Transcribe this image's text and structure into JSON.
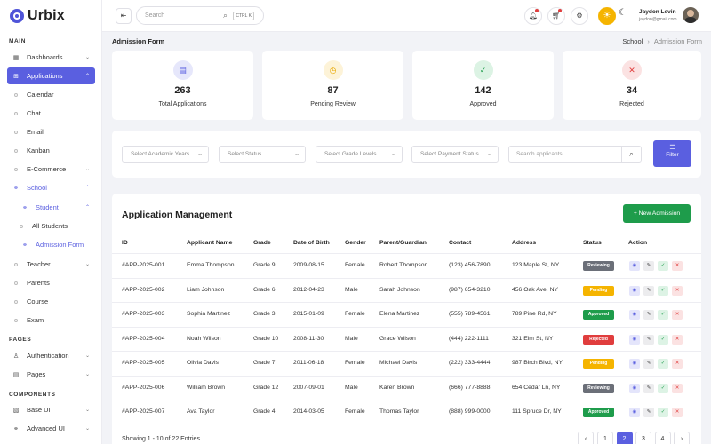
{
  "brand": {
    "name": "Urbix"
  },
  "sidebar": {
    "sections": {
      "main": "MAIN",
      "pages": "PAGES",
      "components": "COMPONENTS"
    },
    "items": {
      "dashboards": "Dashboards",
      "applications": "Applications",
      "calendar": "Calendar",
      "chat": "Chat",
      "email": "Email",
      "kanban": "Kanban",
      "ecommerce": "E-Commerce",
      "school": "School",
      "student": "Student",
      "all_students": "All Students",
      "admission_form": "Admission Form",
      "teacher": "Teacher",
      "parents": "Parents",
      "course": "Course",
      "exam": "Exam",
      "authentication": "Authentication",
      "pages": "Pages",
      "base_ui": "Base UI",
      "advanced_ui": "Advanced UI"
    }
  },
  "header": {
    "search_placeholder": "Search",
    "search_shortcut": "CTRL K",
    "user_name": "Jaydon Levin",
    "user_email": "jaydon@gmail.com"
  },
  "breadcrumb": {
    "title": "Admission Form",
    "parent": "School",
    "current": "Admission Form"
  },
  "stats": [
    {
      "value": "263",
      "label": "Total Applications",
      "color": "#5a5fe0",
      "bg": "#e6e7fb",
      "icon": "document-icon"
    },
    {
      "value": "87",
      "label": "Pending Review",
      "color": "#e8a800",
      "bg": "#fdf3d8",
      "icon": "clock-icon"
    },
    {
      "value": "142",
      "label": "Approved",
      "color": "#1e9c4b",
      "bg": "#dcf3e4",
      "icon": "check-circle-icon"
    },
    {
      "value": "34",
      "label": "Rejected",
      "color": "#e03d3d",
      "bg": "#fbe2e2",
      "icon": "x-circle-icon"
    }
  ],
  "filters": {
    "academic_years": "Select Academic Years",
    "status": "Select Status",
    "grade_levels": "Select Grade Levels",
    "payment_status": "Select Payment Status",
    "search_placeholder": "Search applicants...",
    "filter_label": "Filter"
  },
  "table": {
    "title": "Application Management",
    "new_button": "+ New Admission",
    "columns": [
      "ID",
      "Applicant Name",
      "Grade",
      "Date of Birth",
      "Gender",
      "Parent/Guardian",
      "Contact",
      "Address",
      "Status",
      "Action"
    ],
    "rows": [
      {
        "id": "#APP-2025-001",
        "name": "Emma Thompson",
        "grade": "Grade 9",
        "dob": "2009-08-15",
        "gender": "Female",
        "parent": "Robert Thompson",
        "contact": "(123) 456-7890",
        "address": "123 Maple St, NY",
        "status": "Reviewing"
      },
      {
        "id": "#APP-2025-002",
        "name": "Liam Johnson",
        "grade": "Grade 6",
        "dob": "2012-04-23",
        "gender": "Male",
        "parent": "Sarah Johnson",
        "contact": "(987) 654-3210",
        "address": "456 Oak Ave, NY",
        "status": "Pending"
      },
      {
        "id": "#APP-2025-003",
        "name": "Sophia Martinez",
        "grade": "Grade 3",
        "dob": "2015-01-09",
        "gender": "Female",
        "parent": "Elena Martinez",
        "contact": "(555) 789-4561",
        "address": "789 Pine Rd, NY",
        "status": "Approved"
      },
      {
        "id": "#APP-2025-004",
        "name": "Noah Wilson",
        "grade": "Grade 10",
        "dob": "2008-11-30",
        "gender": "Male",
        "parent": "Grace Wilson",
        "contact": "(444) 222-1111",
        "address": "321 Elm St, NY",
        "status": "Rejected"
      },
      {
        "id": "#APP-2025-005",
        "name": "Olivia Davis",
        "grade": "Grade 7",
        "dob": "2011-06-18",
        "gender": "Female",
        "parent": "Michael Davis",
        "contact": "(222) 333-4444",
        "address": "987 Birch Blvd, NY",
        "status": "Pending"
      },
      {
        "id": "#APP-2025-006",
        "name": "William Brown",
        "grade": "Grade 12",
        "dob": "2007-09-01",
        "gender": "Male",
        "parent": "Karen Brown",
        "contact": "(666) 777-8888",
        "address": "654 Cedar Ln, NY",
        "status": "Reviewing"
      },
      {
        "id": "#APP-2025-007",
        "name": "Ava Taylor",
        "grade": "Grade 4",
        "dob": "2014-03-05",
        "gender": "Female",
        "parent": "Thomas Taylor",
        "contact": "(888) 999-0000",
        "address": "111 Spruce Dr, NY",
        "status": "Approved"
      }
    ],
    "status_colors": {
      "Reviewing": "#6b6f78",
      "Pending": "#f5b400",
      "Approved": "#1e9c4b",
      "Rejected": "#e03d3d"
    },
    "showing": "Showing 1 - 10 of 22 Entries",
    "pages": [
      "1",
      "2",
      "3",
      "4"
    ],
    "active_page": "2"
  }
}
